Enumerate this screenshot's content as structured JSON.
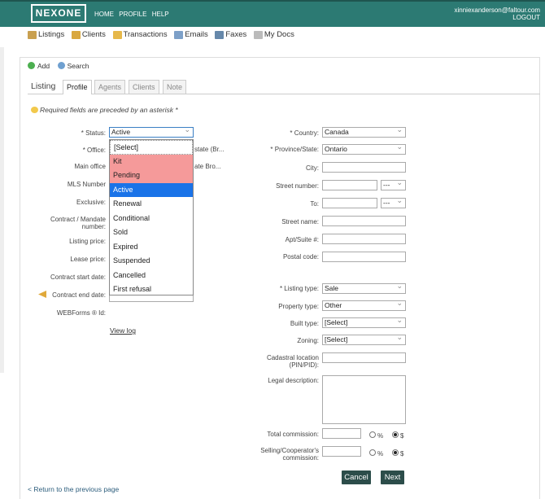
{
  "header": {
    "logo": "NEXONE",
    "nav": [
      "HOME",
      "PROFILE",
      "HELP"
    ],
    "user_email": "xinniexanderson@faltour.com",
    "logout": "LOGOUT"
  },
  "subnav": [
    {
      "label": "Listings",
      "icon": "house-icon",
      "color": "#c9a050"
    },
    {
      "label": "Clients",
      "icon": "user-icon",
      "color": "#d9a840"
    },
    {
      "label": "Transactions",
      "icon": "folder-icon",
      "color": "#e6b84a"
    },
    {
      "label": "Emails",
      "icon": "envelope-icon",
      "color": "#7da0c8"
    },
    {
      "label": "Faxes",
      "icon": "printer-icon",
      "color": "#6688aa"
    },
    {
      "label": "My Docs",
      "icon": "documents-icon",
      "color": "#bbbbbb"
    }
  ],
  "actions": {
    "add": "Add",
    "search": "Search"
  },
  "tabs": [
    "Listing",
    "Profile",
    "Agents",
    "Clients",
    "Note"
  ],
  "note": "Required fields are preceded by an asterisk *",
  "left": {
    "status_label": "* Status:",
    "status_value": "Active",
    "office_label": "* Office:",
    "office_partial": "state (Br...",
    "main_office_label": "Main office",
    "main_office_partial": "ate Bro...",
    "mls_label": "MLS Number",
    "exclusive_label": "Exclusive:",
    "mandate_label": "Contract / Mandate number:",
    "listing_price_label": "Listing price:",
    "lease_price_label": "Lease price:",
    "start_date_label": "Contract start date:",
    "end_date_label": "Contract end date:",
    "webforms_label": "WEBForms ® Id:",
    "view_log": "View log"
  },
  "status_options": [
    "[Select]",
    "Kit",
    "Pending",
    "Active",
    "Renewal",
    "Conditional",
    "Sold",
    "Expired",
    "Suspended",
    "Cancelled",
    "First refusal"
  ],
  "right": {
    "country_label": "* Country:",
    "country_value": "Canada",
    "province_label": "* Province/State:",
    "province_value": "Ontario",
    "city_label": "City:",
    "street_number_label": "Street number:",
    "to_label": "To:",
    "dash_value": "---",
    "street_name_label": "Street name:",
    "apt_label": "Apt/Suite #:",
    "postal_label": "Postal code:",
    "listing_type_label": "* Listing type:",
    "listing_type_value": "Sale",
    "property_type_label": "Property type:",
    "property_type_value": "Other",
    "built_type_label": "Built type:",
    "built_type_value": "[Select]",
    "zoning_label": "Zoning:",
    "zoning_value": "[Select]",
    "cadastral_label": "Cadastral location (PIN/PID):",
    "legal_label": "Legal description:",
    "total_commission_label": "Total commission:",
    "selling_commission_label": "Selling/Cooperator's commission:",
    "percent": "%",
    "dollar": "$"
  },
  "buttons": {
    "cancel": "Cancel",
    "next": "Next"
  },
  "return_link": "< Return to the previous page"
}
